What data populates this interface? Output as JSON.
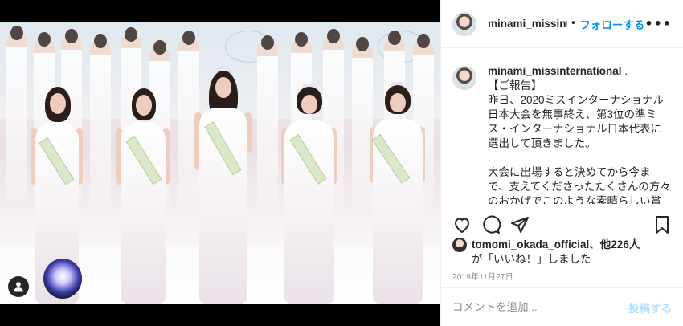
{
  "post": {
    "username": "minami_missinternational",
    "separator": "•",
    "follow_label": "フォローする",
    "more_label": "•••",
    "caption": {
      "username": "minami_missinternational",
      "trailing": " .",
      "lines": [
        "【ご報告】",
        "昨日、2020ミスインターナショナル日本大会を無事終え、第3位の準ミス・インターナショナル日本代表に選出して頂きました。",
        ".",
        "大会に出場すると決めてから今まで、支えてくださったたくさんの方々のおかげでこのような素晴らしい賞を頂け"
      ]
    },
    "likes": {
      "first_user": "tomomi_okada_official",
      "joiner": "、",
      "others": "他226人",
      "suffix": "が「いいね！」しました"
    },
    "date": "2019年11月27日",
    "comment": {
      "placeholder": "コメントを追加...",
      "post_label": "投稿する"
    },
    "icons": {
      "like": "heart-icon",
      "comment": "comment-icon",
      "share": "share-icon",
      "save": "bookmark-icon",
      "user_tag": "person-icon"
    },
    "colors": {
      "accent": "#0095f6",
      "post_disabled": "#b2dffc",
      "muted": "#8e8e8e"
    }
  }
}
